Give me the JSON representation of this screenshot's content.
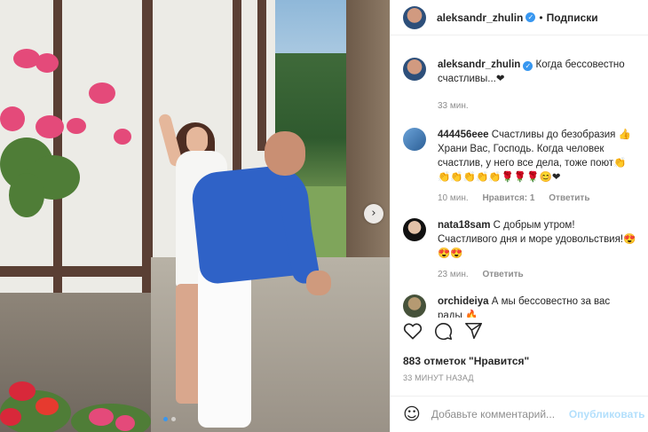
{
  "colors": {
    "accent": "#3897f0",
    "text": "#262626",
    "muted": "#8e8e8e",
    "post_disabled": "#b2dffc"
  },
  "media": {
    "next_arrow_icon": "chevron-right-icon",
    "next_arrow_glyph": "›",
    "carousel_dots": 2,
    "carousel_active_index": 0
  },
  "header": {
    "username": "aleksandr_zhulin",
    "separator": "•",
    "follow_label": "Подписки"
  },
  "caption": {
    "username": "aleksandr_zhulin",
    "text": "Когда бессовестно счастливы...❤",
    "time": "33 мин."
  },
  "comments": [
    {
      "username": "444456eee",
      "text": "Счастливы до безобразия 👍 Храни Вас, Господь. Когда человек счастлив, у него все дела, тоже поют👏👏👏👏👏👏🌹🌹🌹😊❤",
      "time": "10 мин.",
      "likes": "Нравится: 1",
      "reply": "Ответить"
    },
    {
      "username": "nata18sam",
      "text": "С добрым утром! Счастливого дня и море удовольствия!😍😍😍",
      "time": "23 мин.",
      "reply": "Ответить"
    },
    {
      "username": "orchideiya",
      "text": "А мы бессовестно за вас рады 🔥"
    }
  ],
  "actions": {
    "like_icon": "heart-icon",
    "comment_icon": "comment-icon",
    "share_icon": "share-icon"
  },
  "likes": "883 отметок \"Нравится\"",
  "timestamp": "33 МИНУТ НАЗАД",
  "add_comment": {
    "emoji_icon": "smiley-icon",
    "emoji_glyph": "☺",
    "placeholder": "Добавьте комментарий...",
    "post_label": "Опубликовать"
  }
}
